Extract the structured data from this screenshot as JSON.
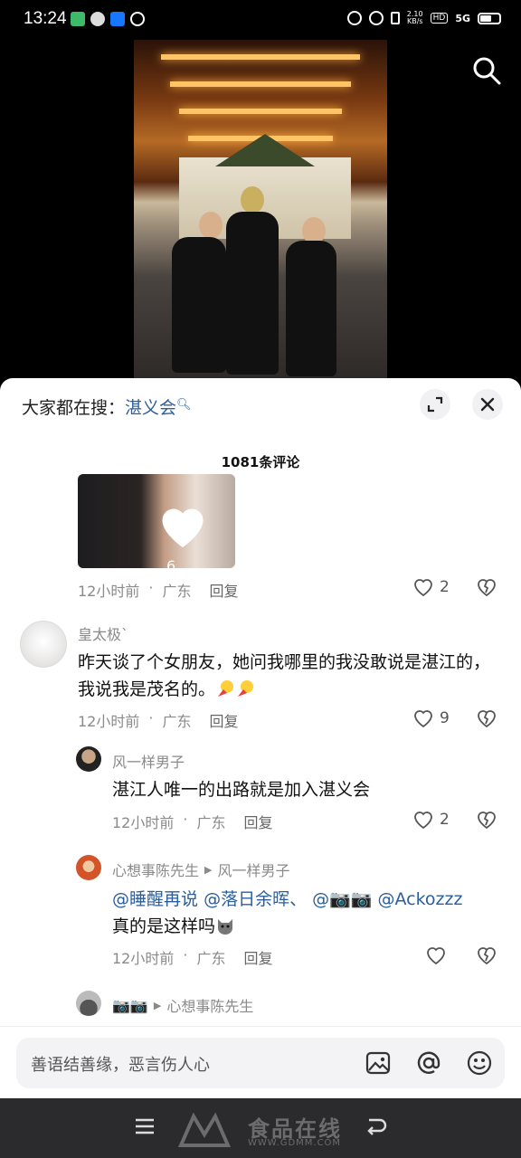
{
  "status_bar": {
    "time": "13:24",
    "network_speed": "2.10\nKB/s",
    "signal": "5G"
  },
  "video": {
    "search_icon": "search-icon"
  },
  "sheet": {
    "search_prefix": "大家都在搜：",
    "search_keyword": "湛义会",
    "comment_count": "1081条评论"
  },
  "comments": [
    {
      "image_like_count": "6",
      "time": "12小时前",
      "dot": "·",
      "location": "广东",
      "reply_label": "回复",
      "likes": "2"
    },
    {
      "user": "皇太极`",
      "text": "昨天谈了个女朋友，她问我哪里的我没敢说是湛江的，我说我是茂名的。",
      "time": "12小时前",
      "dot": "·",
      "location": "广东",
      "reply_label": "回复",
      "likes": "9"
    },
    {
      "user": "风一样男子",
      "text": "湛江人唯一的出路就是加入湛义会",
      "time": "12小时前",
      "dot": "·",
      "location": "广东",
      "reply_label": "回复",
      "likes": "2"
    },
    {
      "user": "心想事陈先生",
      "reply_to": "风一样男子",
      "mention1": "@睡醒再说",
      "mention2": "@落日余晖、",
      "mention3": "@📷📷",
      "mention4": "@Ackozzz",
      "text_line2": "真的是这样吗",
      "time": "12小时前",
      "dot": "·",
      "location": "广东",
      "reply_label": "回复",
      "likes": ""
    },
    {
      "user": "📷📷",
      "reply_to": "心想事陈先生"
    }
  ],
  "input": {
    "placeholder": "善语结善缘，恶言伤人心"
  },
  "watermark": {
    "big": "食品在线",
    "small": "WWW.GDMM.COM"
  },
  "colors": {
    "mention": "#2a5e9e",
    "meta": "#8a8a8a",
    "navbar": "#2b2b2d"
  }
}
